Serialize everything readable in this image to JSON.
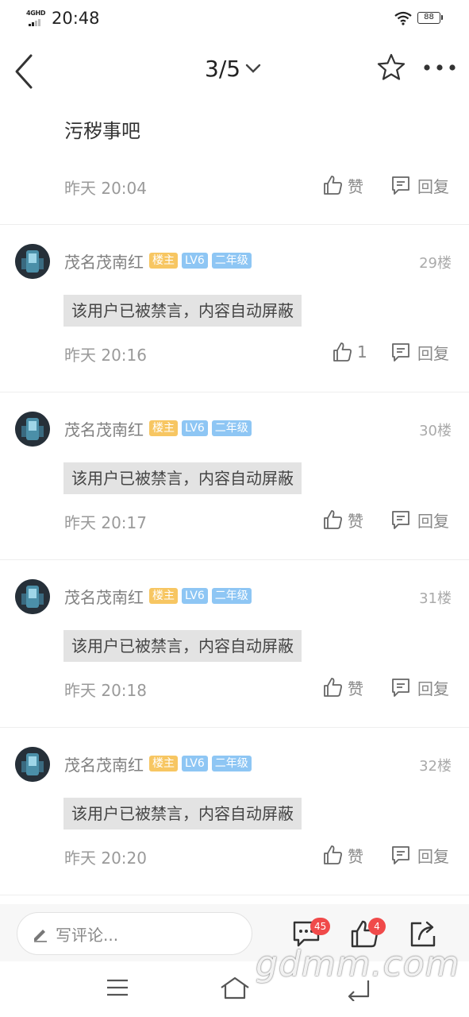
{
  "status_bar": {
    "network": "4GHD",
    "time": "20:48",
    "battery": "88"
  },
  "header": {
    "page": "3/5"
  },
  "first_reply": {
    "text": "污秽事吧",
    "time": "昨天 20:04",
    "like_label": "赞",
    "reply_label": "回复"
  },
  "floors": [
    {
      "username": "茂名茂南红",
      "badge_owner": "楼主",
      "badge_level": "LV6",
      "badge_grade": "二年级",
      "floor": "29楼",
      "content": "该用户已被禁言，内容自动屏蔽",
      "time": "昨天 20:16",
      "like_label": "1",
      "reply_label": "回复"
    },
    {
      "username": "茂名茂南红",
      "badge_owner": "楼主",
      "badge_level": "LV6",
      "badge_grade": "二年级",
      "floor": "30楼",
      "content": "该用户已被禁言，内容自动屏蔽",
      "time": "昨天 20:17",
      "like_label": "赞",
      "reply_label": "回复"
    },
    {
      "username": "茂名茂南红",
      "badge_owner": "楼主",
      "badge_level": "LV6",
      "badge_grade": "二年级",
      "floor": "31楼",
      "content": "该用户已被禁言，内容自动屏蔽",
      "time": "昨天 20:18",
      "like_label": "赞",
      "reply_label": "回复"
    },
    {
      "username": "茂名茂南红",
      "badge_owner": "楼主",
      "badge_level": "LV6",
      "badge_grade": "二年级",
      "floor": "32楼",
      "content": "该用户已被禁言，内容自动屏蔽",
      "time": "昨天 20:20",
      "like_label": "赞",
      "reply_label": "回复"
    }
  ],
  "bottom_bar": {
    "comment_placeholder": "写评论...",
    "comment_count": "45",
    "like_count": "4"
  },
  "watermark": "gdmm.com",
  "colors": {
    "badge_owner": "#f7c662",
    "badge_level": "#8ec6f4",
    "notification_badge": "#f04a4a",
    "banned_bg": "#e3e3e3"
  }
}
